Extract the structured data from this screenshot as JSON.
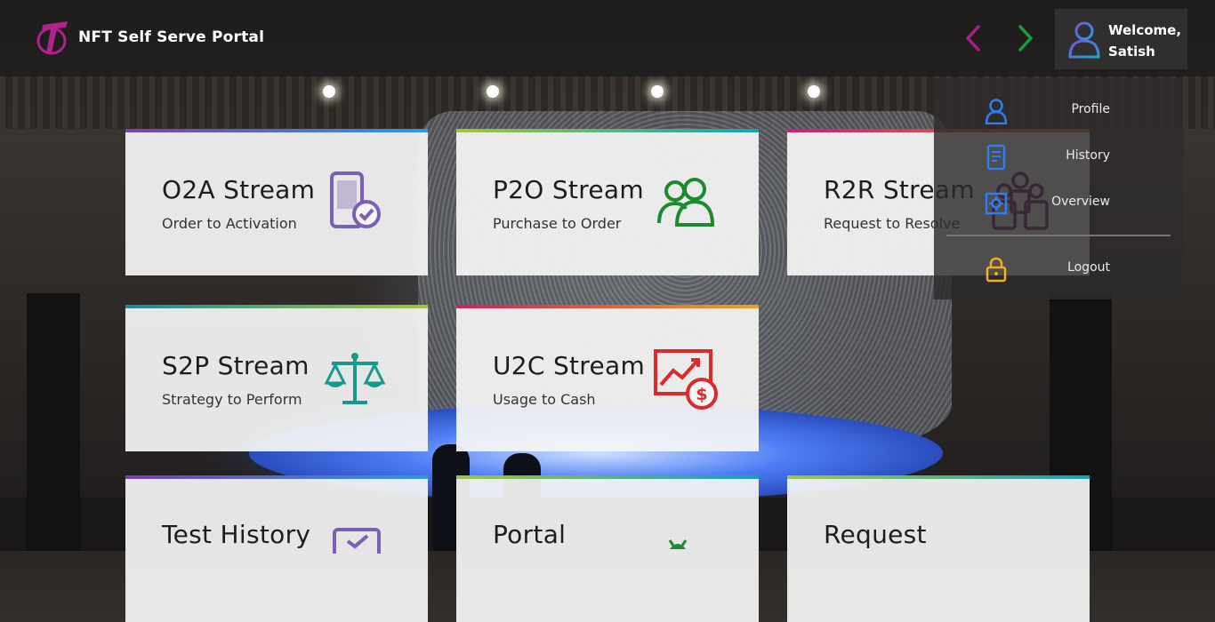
{
  "header": {
    "title": "NFT Self Serve Portal",
    "prev_icon": "chevron-left-icon",
    "next_icon": "chevron-right-icon",
    "user": {
      "welcome": "Welcome,",
      "name": "Satish",
      "icon": "user-avatar-icon"
    }
  },
  "user_menu": {
    "items": [
      {
        "label": "Profile",
        "icon": "user-icon"
      },
      {
        "label": "History",
        "icon": "document-icon"
      },
      {
        "label": "Overview",
        "icon": "settings-icon"
      },
      {
        "label": "Logout",
        "icon": "lock-icon"
      }
    ]
  },
  "cards": [
    {
      "title": "O2A Stream",
      "subtitle": "Order to Activation",
      "icon": "mobile-check-icon",
      "color": "#7b5fb4"
    },
    {
      "title": "P2O Stream",
      "subtitle": "Purchase to Order",
      "icon": "people-icon",
      "color": "#1c8a2e"
    },
    {
      "title": "R2R Stream",
      "subtitle": "Request to Resolve",
      "icon": "team-icon",
      "color": "#6a1f6e"
    },
    {
      "title": "S2P Stream",
      "subtitle": "Strategy to Perform",
      "icon": "scales-icon",
      "color": "#159a8c"
    },
    {
      "title": "U2C Stream",
      "subtitle": "Usage to Cash",
      "icon": "chart-dollar-icon",
      "color": "#d92b2b"
    },
    {
      "title": "Test History",
      "subtitle": "",
      "icon": "checklist-icon",
      "color": "#7b5fb4"
    },
    {
      "title": "Portal",
      "subtitle": "",
      "icon": "bug-icon",
      "color": "#1c8a2e"
    },
    {
      "title": "Request",
      "subtitle": "",
      "icon": "",
      "color": "#333333"
    }
  ],
  "colors": {
    "accent_purple": "#a0208c",
    "accent_green": "#1c9a3c",
    "menu_blue": "#2f7ef0",
    "menu_gold": "#f0b020"
  }
}
